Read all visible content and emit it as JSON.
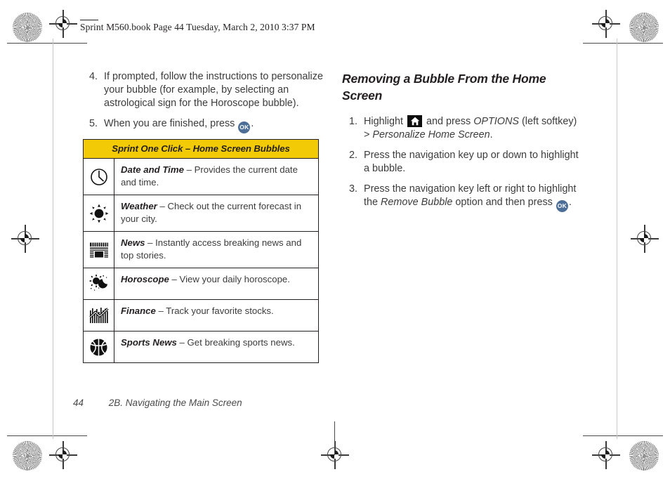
{
  "running_header": "Sprint M560.book  Page 44  Tuesday, March 2, 2010  3:37 PM",
  "left_column": {
    "steps": [
      {
        "num": "4.",
        "parts": [
          {
            "type": "text",
            "value": "If prompted, follow the instructions to personalize your bubble (for example, by selecting an astrological sign for the Horoscope bubble)."
          }
        ]
      },
      {
        "num": "5.",
        "parts": [
          {
            "type": "text",
            "value": "When you are finished, press "
          },
          {
            "type": "okkey",
            "value": "OK"
          },
          {
            "type": "text",
            "value": "."
          }
        ]
      }
    ]
  },
  "table": {
    "title": "Sprint One Click – Home Screen Bubbles",
    "header_bg": "#f2ca05",
    "rows": [
      {
        "icon": "clock-icon",
        "name": "Date and Time",
        "dash": " – ",
        "desc": "Provides the current date and time."
      },
      {
        "icon": "sun-weather-icon",
        "name": "Weather",
        "dash": " – ",
        "desc": "Check out the current forecast in your city."
      },
      {
        "icon": "newspaper-icon",
        "name": "News",
        "dash": " – ",
        "desc": "Instantly access breaking news and top stories."
      },
      {
        "icon": "sun-moon-horoscope-icon",
        "name": "Horoscope",
        "dash": " – ",
        "desc": "View your daily horoscope."
      },
      {
        "icon": "stock-chart-icon",
        "name": "Finance",
        "dash": " – ",
        "desc": "Track your favorite stocks."
      },
      {
        "icon": "basketball-icon",
        "name": "Sports News",
        "dash": " – ",
        "desc": "Get breaking sports news."
      }
    ]
  },
  "right_column": {
    "heading": "Removing a Bubble From the Home Screen",
    "steps": [
      {
        "num": "1.",
        "parts": [
          {
            "type": "text",
            "value": "Highlight "
          },
          {
            "type": "homekey",
            "value": "home-icon"
          },
          {
            "type": "text",
            "value": " and press "
          },
          {
            "type": "italic",
            "value": "OPTIONS"
          },
          {
            "type": "text",
            "value": " (left softkey) > "
          },
          {
            "type": "italic",
            "value": "Personalize Home Screen"
          },
          {
            "type": "text",
            "value": "."
          }
        ]
      },
      {
        "num": "2.",
        "parts": [
          {
            "type": "text",
            "value": "Press the navigation key up or down to highlight a bubble."
          }
        ]
      },
      {
        "num": "3.",
        "parts": [
          {
            "type": "text",
            "value": "Press the navigation key left or right to highlight the "
          },
          {
            "type": "italic",
            "value": "Remove Bubble"
          },
          {
            "type": "text",
            "value": " option and then press "
          },
          {
            "type": "okkey",
            "value": "OK"
          },
          {
            "type": "text",
            "value": "."
          }
        ]
      }
    ]
  },
  "footer": {
    "page_number": "44",
    "section_title": "2B. Navigating the Main Screen"
  },
  "print_marks": {
    "registration_label": "registration-target",
    "density_label": "density-starburst"
  }
}
